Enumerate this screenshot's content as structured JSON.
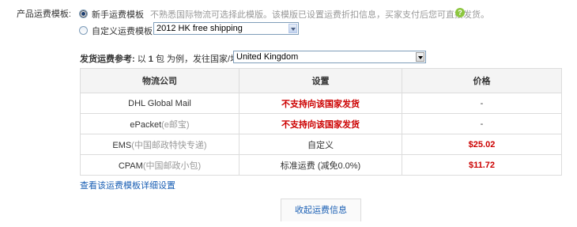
{
  "template": {
    "label": "产品运费模板:",
    "option_new": "新手运费模板",
    "option_new_hint": "不熟悉国际物流可选择此模版。该模版已设置运费折扣信息，买家支付后您可直接发货。",
    "help_icon": "question-icon",
    "option_custom": "自定义运费模板",
    "custom_select_value": "2012 HK free shipping"
  },
  "reference": {
    "label_bold": "发货运费参考:",
    "text_1": "以",
    "count": "1",
    "text_2": "包 为例，发往国家/地区",
    "country": "United Kingdom"
  },
  "table": {
    "headers": [
      "物流公司",
      "设置",
      "价格"
    ],
    "rows": [
      {
        "name": "DHL Global Mail",
        "sub": "",
        "setting": "不支持向该国家发货",
        "setting_red": true,
        "price": "-",
        "price_red": false
      },
      {
        "name": "ePacket",
        "sub": "(e邮宝)",
        "setting": "不支持向该国家发货",
        "setting_red": true,
        "price": "-",
        "price_red": false
      },
      {
        "name": "EMS",
        "sub": "(中国邮政特快专递)",
        "setting": "自定义",
        "setting_red": false,
        "price": "$25.02",
        "price_red": true
      },
      {
        "name": "CPAM",
        "sub": "(中国邮政小包)",
        "setting": "标准运费 (减免0.0%)",
        "setting_red": false,
        "price": "$11.72",
        "price_red": true
      }
    ]
  },
  "detail_link": "查看该运费模板详细设置",
  "collapse_button": "收起运费信息",
  "colors": {
    "link": "#1a5fb4",
    "warning": "#cc0000",
    "hint": "#999999"
  }
}
